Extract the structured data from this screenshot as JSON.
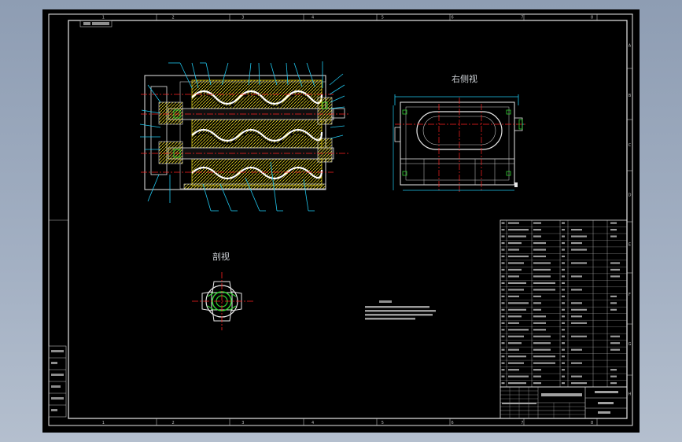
{
  "drawing": {
    "view_titles": {
      "side_view": "右侧视",
      "section_view": "剖视"
    },
    "border_columns": [
      "1",
      "2",
      "3",
      "4",
      "5",
      "6",
      "7",
      "8"
    ],
    "border_rows": [
      "A",
      "B",
      "C",
      "D",
      "E",
      "F",
      "G",
      "H"
    ],
    "colors": {
      "background": "#000000",
      "frame": "#e8e8e8",
      "hatch": "#e0d020",
      "dimension": "#20c8f0",
      "centerline": "#ff2020",
      "part": "#30d030"
    }
  }
}
